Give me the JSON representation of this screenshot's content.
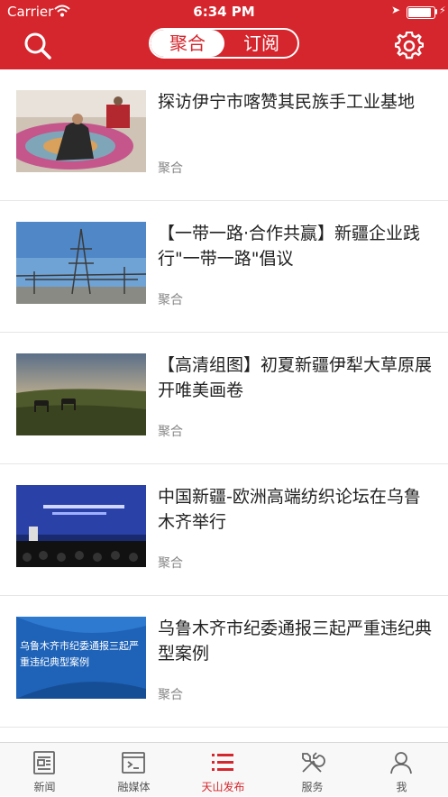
{
  "status_bar": {
    "carrier": "Carrier",
    "time": "6:34 PM",
    "battery_level": 0.9
  },
  "header": {
    "search_icon": "search-icon",
    "settings_icon": "gear-icon",
    "segments": [
      "聚合",
      "订阅"
    ],
    "active_segment": "聚合"
  },
  "articles": [
    {
      "title": "探访伊宁市喀赞其民族手工业基地",
      "tag": "聚合"
    },
    {
      "title": "【一带一路·合作共赢】新疆企业践行\"一带一路\"倡议",
      "tag": "聚合"
    },
    {
      "title": "【高清组图】初夏新疆伊犁大草原展开唯美画卷",
      "tag": "聚合"
    },
    {
      "title": "中国新疆-欧洲高端纺织论坛在乌鲁木齐举行",
      "tag": "聚合"
    },
    {
      "title": "乌鲁木齐市纪委通报三起严重违纪典型案例",
      "tag": "聚合",
      "thumb_text": "乌鲁木齐市纪委通报三起严重违纪典型案例"
    }
  ],
  "tabbar": {
    "tabs": [
      {
        "label": "新闻",
        "icon": "newspaper-icon"
      },
      {
        "label": "融媒体",
        "icon": "media-icon"
      },
      {
        "label": "天山发布",
        "icon": "list-icon"
      },
      {
        "label": "服务",
        "icon": "tools-icon"
      },
      {
        "label": "我",
        "icon": "person-icon"
      }
    ],
    "active": "天山发布"
  },
  "colors": {
    "brand": "#d6262d"
  }
}
